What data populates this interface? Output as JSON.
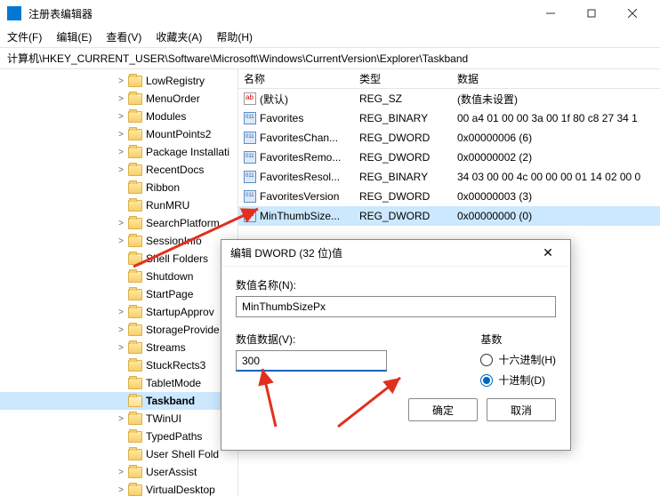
{
  "window": {
    "title": "注册表编辑器"
  },
  "menu": {
    "file": "文件(F)",
    "edit": "编辑(E)",
    "view": "查看(V)",
    "favorites": "收藏夹(A)",
    "help": "帮助(H)"
  },
  "address": "计算机\\HKEY_CURRENT_USER\\Software\\Microsoft\\Windows\\CurrentVersion\\Explorer\\Taskband",
  "tree": [
    {
      "label": "LowRegistry",
      "chev": ">"
    },
    {
      "label": "MenuOrder",
      "chev": ">"
    },
    {
      "label": "Modules",
      "chev": ">"
    },
    {
      "label": "MountPoints2",
      "chev": ">"
    },
    {
      "label": "Package Installati",
      "chev": ">"
    },
    {
      "label": "RecentDocs",
      "chev": ">"
    },
    {
      "label": "Ribbon",
      "chev": ""
    },
    {
      "label": "RunMRU",
      "chev": ""
    },
    {
      "label": "SearchPlatform",
      "chev": ">"
    },
    {
      "label": "SessionInfo",
      "chev": ">"
    },
    {
      "label": "Shell Folders",
      "chev": ""
    },
    {
      "label": "Shutdown",
      "chev": ""
    },
    {
      "label": "StartPage",
      "chev": ""
    },
    {
      "label": "StartupApprov",
      "chev": ">"
    },
    {
      "label": "StorageProvide",
      "chev": ">"
    },
    {
      "label": "Streams",
      "chev": ">"
    },
    {
      "label": "StuckRects3",
      "chev": ""
    },
    {
      "label": "TabletMode",
      "chev": ""
    },
    {
      "label": "Taskband",
      "chev": "",
      "selected": true,
      "open": true
    },
    {
      "label": "TWinUI",
      "chev": ">"
    },
    {
      "label": "TypedPaths",
      "chev": ""
    },
    {
      "label": "User Shell Fold",
      "chev": ""
    },
    {
      "label": "UserAssist",
      "chev": ">"
    },
    {
      "label": "VirtualDesktop",
      "chev": ">"
    }
  ],
  "columns": {
    "name": "名称",
    "type": "类型",
    "data": "数据"
  },
  "rows": [
    {
      "icon": "sz",
      "name": "(默认)",
      "type": "REG_SZ",
      "data": "(数值未设置)"
    },
    {
      "icon": "bin",
      "name": "Favorites",
      "type": "REG_BINARY",
      "data": "00 a4 01 00 00 3a 00 1f 80 c8 27 34 1"
    },
    {
      "icon": "bin",
      "name": "FavoritesChan...",
      "type": "REG_DWORD",
      "data": "0x00000006 (6)"
    },
    {
      "icon": "bin",
      "name": "FavoritesRemo...",
      "type": "REG_DWORD",
      "data": "0x00000002 (2)"
    },
    {
      "icon": "bin",
      "name": "FavoritesResol...",
      "type": "REG_BINARY",
      "data": "34 03 00 00 4c 00 00 00 01 14 02 00 0"
    },
    {
      "icon": "bin",
      "name": "FavoritesVersion",
      "type": "REG_DWORD",
      "data": "0x00000003 (3)"
    },
    {
      "icon": "bin",
      "name": "MinThumbSize...",
      "type": "REG_DWORD",
      "data": "0x00000000 (0)",
      "selected": true
    }
  ],
  "dialog": {
    "title": "编辑 DWORD (32 位)值",
    "name_label": "数值名称(N):",
    "name_value": "MinThumbSizePx",
    "data_label": "数值数据(V):",
    "data_value": "300",
    "base_label": "基数",
    "hex_label": "十六进制(H)",
    "dec_label": "十进制(D)",
    "ok": "确定",
    "cancel": "取消"
  }
}
